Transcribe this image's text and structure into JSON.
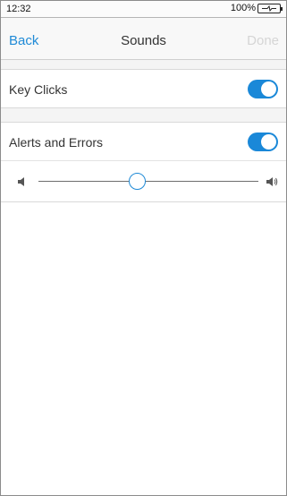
{
  "status_bar": {
    "time": "12:32",
    "battery_percent": "100%",
    "battery_icon": "battery-charging-icon"
  },
  "nav": {
    "back_label": "Back",
    "title": "Sounds",
    "done_label": "Done"
  },
  "settings": {
    "key_clicks": {
      "label": "Key Clicks",
      "enabled": true
    },
    "alerts_and_errors": {
      "label": "Alerts and Errors",
      "enabled": true
    },
    "volume": {
      "value": 0.45,
      "min_icon": "speaker-low-icon",
      "max_icon": "speaker-high-icon"
    }
  },
  "colors": {
    "accent": "#1f8ad6",
    "toggle_on": "#1a88d8",
    "disabled_text": "#d5d5d5"
  }
}
